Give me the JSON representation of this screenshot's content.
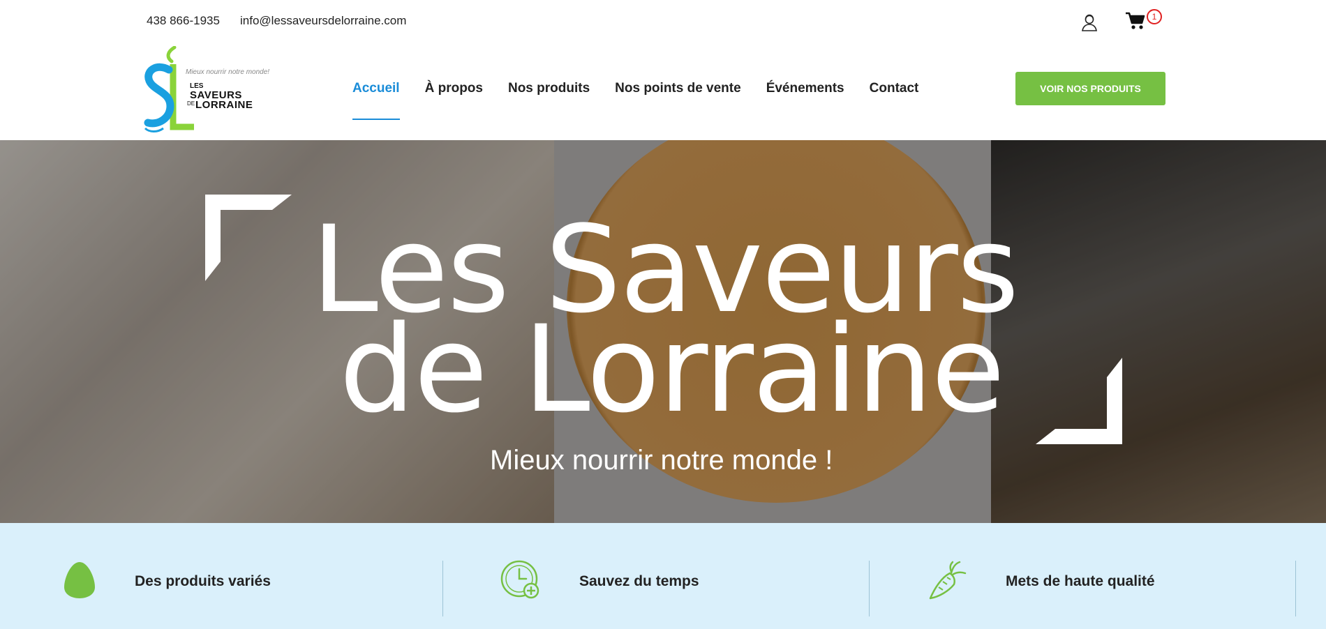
{
  "topbar": {
    "phone": "438 866-1935",
    "email": "info@lessaveursdelorraine.com",
    "user_icon": "user-account-icon",
    "cart_icon": "shopping-cart-icon",
    "cart_count": "1"
  },
  "logo": {
    "tagline": "Mieux nourrir notre monde!",
    "word_les": "LES",
    "word_saveurs": "SAVEURS",
    "word_de": "DE",
    "word_lorraine": "LORRAINE",
    "colors": {
      "blue": "#1a8cd8",
      "green": "#8ad33a"
    }
  },
  "nav": {
    "items": [
      {
        "label": "Accueil",
        "active": true
      },
      {
        "label": "À propos",
        "active": false
      },
      {
        "label": "Nos produits",
        "active": false
      },
      {
        "label": "Nos points de vente",
        "active": false
      },
      {
        "label": "Événements",
        "active": false
      },
      {
        "label": "Contact",
        "active": false
      }
    ],
    "active_color": "#1a8cd8"
  },
  "cta": {
    "label": "VOIR NOS PRODUITS",
    "color": "#76c043"
  },
  "hero": {
    "title_line1": "Les Saveurs",
    "title_line2": "de Lorraine",
    "subtitle": "Mieux nourrir notre monde !"
  },
  "features": [
    {
      "label": "Des produits variés",
      "icon": "egg-icon"
    },
    {
      "label": "Sauvez du temps",
      "icon": "clock-plus-icon"
    },
    {
      "label": "Mets de haute qualité",
      "icon": "carrot-icon"
    }
  ],
  "colors": {
    "feature_bg": "#daf0fb",
    "icon_green": "#76c043",
    "badge_red": "#e02020"
  }
}
